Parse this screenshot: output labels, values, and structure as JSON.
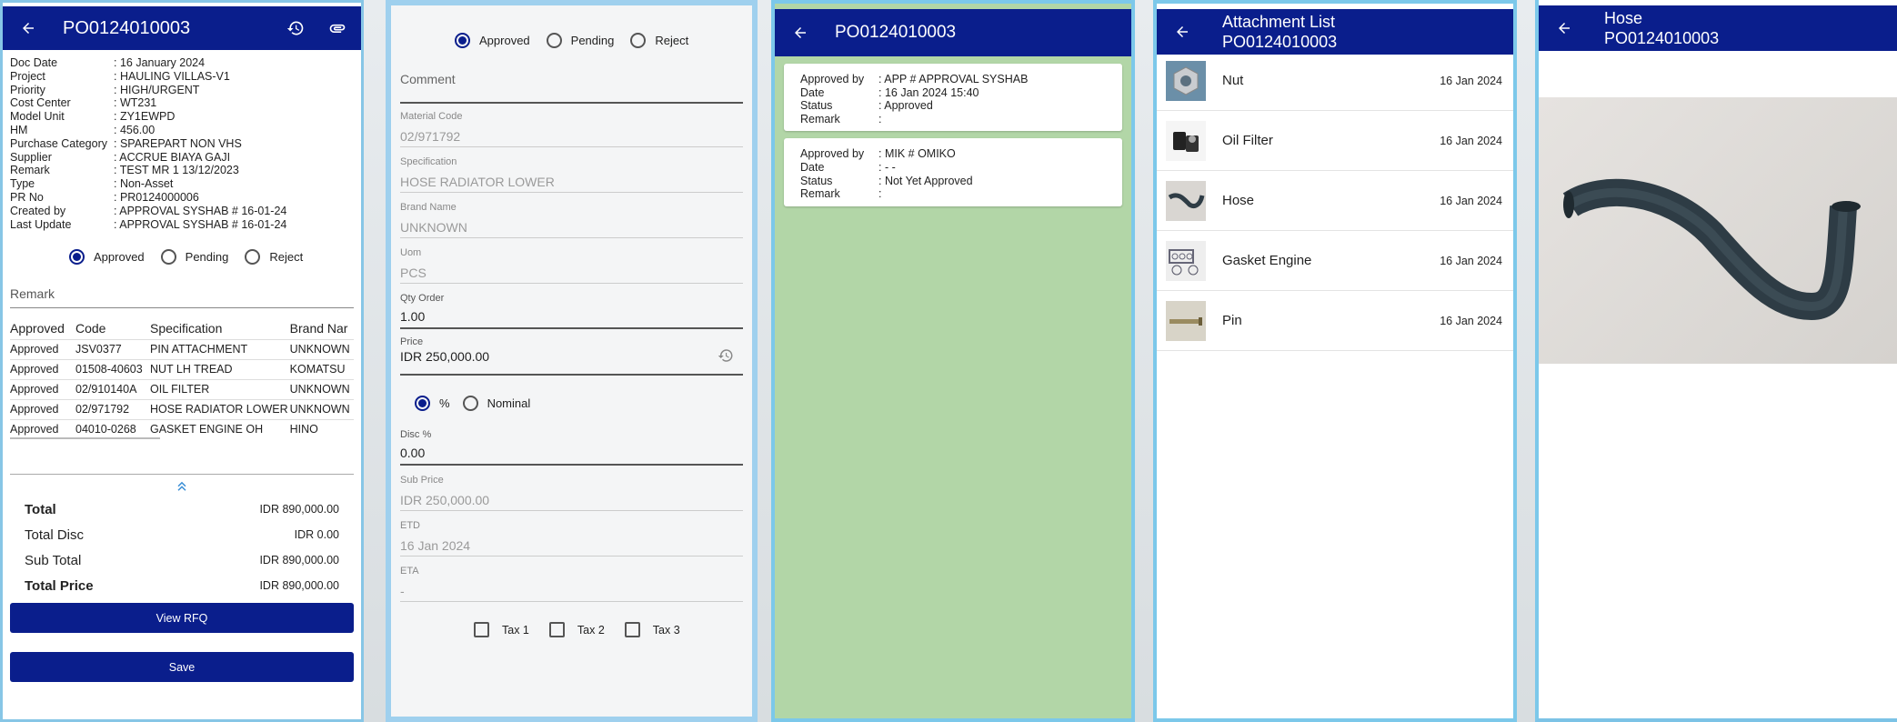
{
  "panel1": {
    "title": "PO0124010003",
    "info": [
      {
        "label": "Doc Date",
        "value": ": 16 January 2024"
      },
      {
        "label": "Project",
        "value": ": HAULING VILLAS-V1"
      },
      {
        "label": "Priority",
        "value": ": HIGH/URGENT"
      },
      {
        "label": "Cost Center",
        "value": ": WT231"
      },
      {
        "label": "Model Unit",
        "value": ": ZY1EWPD"
      },
      {
        "label": "HM",
        "value": ": 456.00"
      },
      {
        "label": "Purchase Category",
        "value": ": SPAREPART NON VHS"
      },
      {
        "label": "Supplier",
        "value": ": ACCRUE BIAYA GAJI"
      },
      {
        "label": "Remark",
        "value": ": TEST MR 1 13/12/2023"
      },
      {
        "label": "Type",
        "value": ": Non-Asset"
      },
      {
        "label": "PR No",
        "value": ": PR0124000006"
      },
      {
        "label": "Created by",
        "value": ": APPROVAL SYSHAB # 16-01-24"
      },
      {
        "label": "Last Update",
        "value": ": APPROVAL SYSHAB # 16-01-24"
      }
    ],
    "radios": [
      "Approved",
      "Pending",
      "Reject"
    ],
    "remark_placeholder": "Remark",
    "table_headers": [
      "Approved",
      "Code",
      "Specification",
      "Brand Nar"
    ],
    "table_rows": [
      [
        "Approved",
        "JSV0377",
        "PIN ATTACHMENT",
        "UNKNOWN"
      ],
      [
        "Approved",
        "01508-40603",
        "NUT LH TREAD",
        "KOMATSU"
      ],
      [
        "Approved",
        "02/910140A",
        "OIL FILTER",
        "UNKNOWN"
      ],
      [
        "Approved",
        "02/971792",
        "HOSE RADIATOR LOWER",
        "UNKNOWN"
      ],
      [
        "Approved",
        "04010-0268",
        "GASKET ENGINE OH",
        "HINO"
      ]
    ],
    "totals": [
      {
        "label": "Total",
        "value": "IDR 890,000.00",
        "bold": true
      },
      {
        "label": "Total Disc",
        "value": "IDR 0.00",
        "bold": false
      },
      {
        "label": "Sub Total",
        "value": "IDR 890,000.00",
        "bold": false
      },
      {
        "label": "Total Price",
        "value": "IDR 890,000.00",
        "bold": true
      }
    ],
    "view_rfq": "View RFQ",
    "save": "Save"
  },
  "panel2": {
    "radios": [
      "Approved",
      "Pending",
      "Reject"
    ],
    "comment_placeholder": "Comment",
    "fields": [
      {
        "label": "Material Code",
        "value": "02/971792"
      },
      {
        "label": "Specification",
        "value": "HOSE RADIATOR LOWER"
      },
      {
        "label": "Brand Name",
        "value": "UNKNOWN"
      },
      {
        "label": "Uom",
        "value": "PCS"
      }
    ],
    "qty": {
      "label": "Qty Order",
      "value": "1.00"
    },
    "price": {
      "label": "Price",
      "value": "IDR 250,000.00"
    },
    "disc_radios": [
      "%",
      "Nominal"
    ],
    "disc": {
      "label": "Disc %",
      "value": "0.00"
    },
    "fields2": [
      {
        "label": "Sub Price",
        "value": "IDR 250,000.00"
      },
      {
        "label": "ETD",
        "value": "16 Jan 2024"
      },
      {
        "label": "ETA",
        "value": "-"
      }
    ],
    "taxes": [
      "Tax 1",
      "Tax 2",
      "Tax 3"
    ]
  },
  "panel3": {
    "title": "PO0124010003",
    "cards": [
      {
        "rows": [
          {
            "k": "Approved by",
            "v": ": APP # APPROVAL SYSHAB"
          },
          {
            "k": "Date",
            "v": ": 16 Jan 2024 15:40"
          },
          {
            "k": "Status",
            "v": ": Approved"
          },
          {
            "k": "Remark",
            "v": ":"
          }
        ]
      },
      {
        "rows": [
          {
            "k": "Approved by",
            "v": ": MIK # OMIKO"
          },
          {
            "k": "Date",
            "v": ": - -"
          },
          {
            "k": "Status",
            "v": ": Not Yet Approved"
          },
          {
            "k": "Remark",
            "v": ":"
          }
        ]
      }
    ]
  },
  "panel4": {
    "title_line1": "Attachment List",
    "title_line2": "PO0124010003",
    "items": [
      {
        "name": "Nut",
        "date": "16 Jan 2024",
        "icon": "nut"
      },
      {
        "name": "Oil Filter",
        "date": "16 Jan 2024",
        "icon": "oil-filter"
      },
      {
        "name": "Hose",
        "date": "16 Jan 2024",
        "icon": "hose"
      },
      {
        "name": "Gasket Engine",
        "date": "16 Jan 2024",
        "icon": "gasket"
      },
      {
        "name": "Pin",
        "date": "16 Jan 2024",
        "icon": "pin"
      }
    ]
  },
  "panel5": {
    "title_line1": "Hose",
    "title_line2": "PO0124010003"
  }
}
